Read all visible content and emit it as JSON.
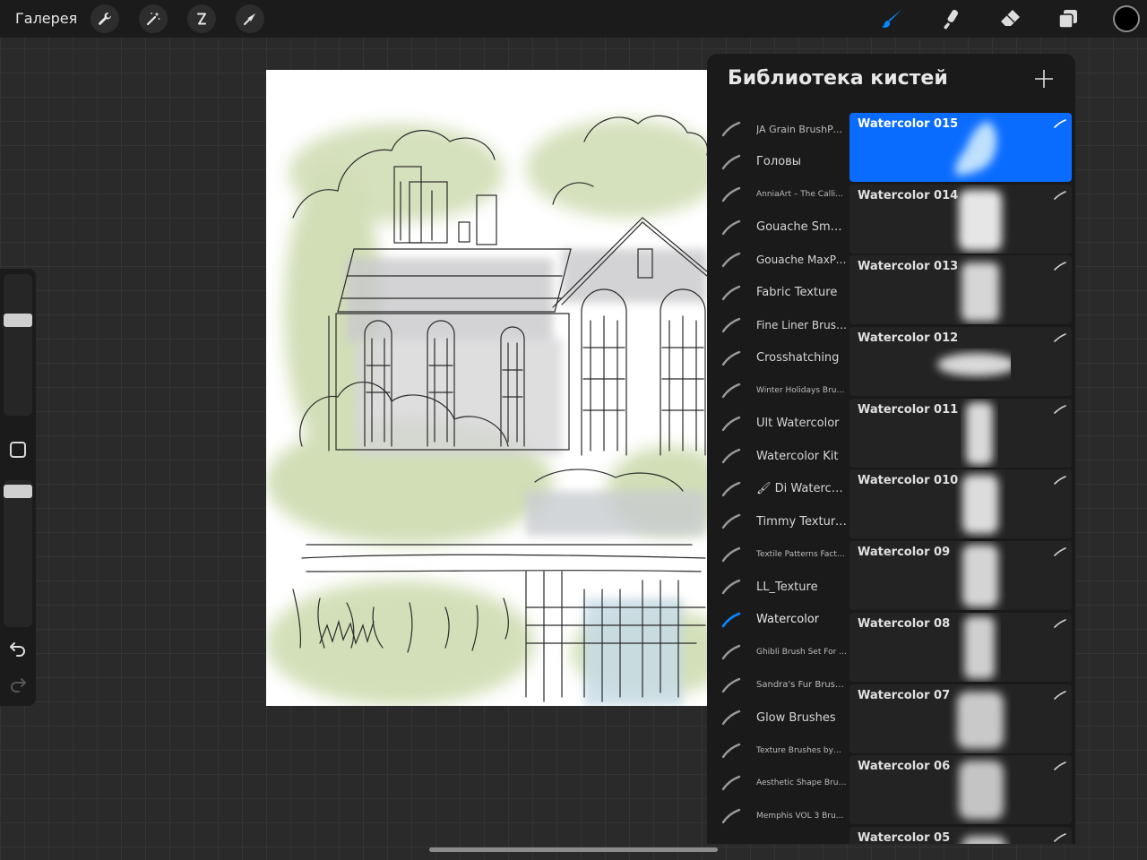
{
  "topbar": {
    "gallery_label": "Галерея",
    "left_tools": [
      "wrench-icon",
      "magic-wand-icon",
      "selection-icon",
      "transform-arrow-icon"
    ],
    "right_tools": [
      "brush-icon",
      "smudge-icon",
      "eraser-icon",
      "layers-icon"
    ],
    "active_tool": "brush-icon",
    "accent_color": "#0a84ff",
    "current_color": "#000000"
  },
  "sidebar": {
    "brush_size_level": 0.55,
    "opacity_level": 1.0,
    "undo_icon": "undo-icon",
    "redo_icon": "redo-icon"
  },
  "library": {
    "title": "Библиотека кистей",
    "add_icon": "plus-icon",
    "sets": [
      {
        "label": "JA Grain BrushPack",
        "size": "small-ish"
      },
      {
        "label": "Головы",
        "size": "big"
      },
      {
        "label": "AnniaArt – The Calligraphy…",
        "size": "small"
      },
      {
        "label": "Gouache Smudge",
        "size": "big"
      },
      {
        "label": "Gouache MaxPack",
        "size": "big"
      },
      {
        "label": "Fabric Texture",
        "size": "big"
      },
      {
        "label": "Fine Liner Brushes",
        "size": "big"
      },
      {
        "label": "Crosshatching",
        "size": "big"
      },
      {
        "label": "Winter Holidays Brushes",
        "size": "small"
      },
      {
        "label": "Ult Watercolor",
        "size": "big"
      },
      {
        "label": "Watercolor Kit",
        "size": "big"
      },
      {
        "label": "🖌 Di Watercolor",
        "size": "big"
      },
      {
        "label": "Timmy Textures",
        "size": "big"
      },
      {
        "label": "Textile Patterns Factory",
        "size": "small"
      },
      {
        "label": "LL_Texture",
        "size": "big"
      },
      {
        "label": "Watercolor",
        "size": "big",
        "active": true
      },
      {
        "label": "Ghibli Brush Set For Procreate",
        "size": "small"
      },
      {
        "label": "Sandra's Fur Brushes",
        "size": "small"
      },
      {
        "label": "Glow Brushes",
        "size": "big"
      },
      {
        "label": "Texture Brushes by…",
        "size": "small"
      },
      {
        "label": "Aesthetic Shape Brushes",
        "size": "small"
      },
      {
        "label": "Memphis VOL 3 Brushes",
        "size": "small"
      }
    ],
    "brushes": [
      {
        "name": "Watercolor 015",
        "selected": true
      },
      {
        "name": "Watercolor 014"
      },
      {
        "name": "Watercolor 013"
      },
      {
        "name": "Watercolor 012"
      },
      {
        "name": "Watercolor 011"
      },
      {
        "name": "Watercolor 010"
      },
      {
        "name": "Watercolor 09"
      },
      {
        "name": "Watercolor 08"
      },
      {
        "name": "Watercolor 07"
      },
      {
        "name": "Watercolor 06"
      },
      {
        "name": "Watercolor 05"
      }
    ]
  }
}
